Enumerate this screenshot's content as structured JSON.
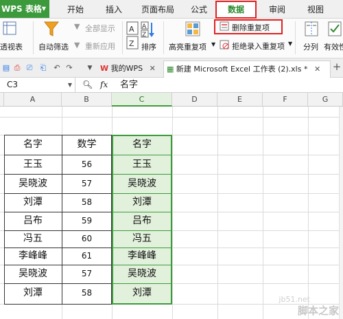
{
  "menubar": {
    "app_name": "WPS 表格",
    "tabs": [
      "开始",
      "插入",
      "页面布局",
      "公式",
      "数据",
      "审阅",
      "视图"
    ],
    "active_tab": "数据"
  },
  "ribbon": {
    "pivot_label": "透视表",
    "autofilter_label": "自动筛选",
    "show_all_label": "全部显示",
    "reapply_label": "重新应用",
    "sort_label": "排序",
    "highlight_dup_label": "高亮重复项",
    "remove_dup_label": "删除重复项",
    "reject_dup_label": "拒绝录入重复项",
    "split_label": "分列",
    "valid_label": "有效性"
  },
  "tabs": {
    "my_wps": "我的WPS",
    "doc_title": "新建 Microsoft Excel 工作表 (2).xls *"
  },
  "formula_bar": {
    "cell_ref": "C3",
    "fx": "fx",
    "content": "名字"
  },
  "sheet": {
    "columns": [
      "A",
      "B",
      "C",
      "D",
      "E",
      "F",
      "G"
    ],
    "header_row": [
      "名字",
      "数学",
      "名字"
    ],
    "rows": [
      [
        "王玉",
        "56",
        "王玉"
      ],
      [
        "吴晓波",
        "57",
        "吴晓波"
      ],
      [
        "刘潭",
        "58",
        "刘潭"
      ],
      [
        "吕布",
        "59",
        "吕布"
      ],
      [
        "冯五",
        "60",
        "冯五"
      ],
      [
        "李峰峰",
        "61",
        "李峰峰"
      ],
      [
        "吴晓波",
        "57",
        "吴晓波"
      ],
      [
        "刘潭",
        "58",
        "刘潭"
      ]
    ]
  },
  "watermark": {
    "site": "jb51.net",
    "brand": "脚本之家"
  }
}
